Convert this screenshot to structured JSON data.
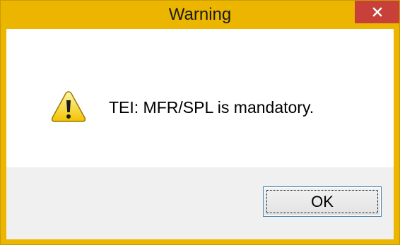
{
  "dialog": {
    "title": "Warning",
    "close_icon": "close-icon",
    "warning_icon": "warning-triangle-icon",
    "message": "TEI: MFR/SPL is mandatory.",
    "ok_label": "OK"
  },
  "colors": {
    "frame": "#ecb600",
    "close_button": "#c7403a",
    "footer_background": "#f0f0f0",
    "button_border": "#3c7fb1"
  }
}
